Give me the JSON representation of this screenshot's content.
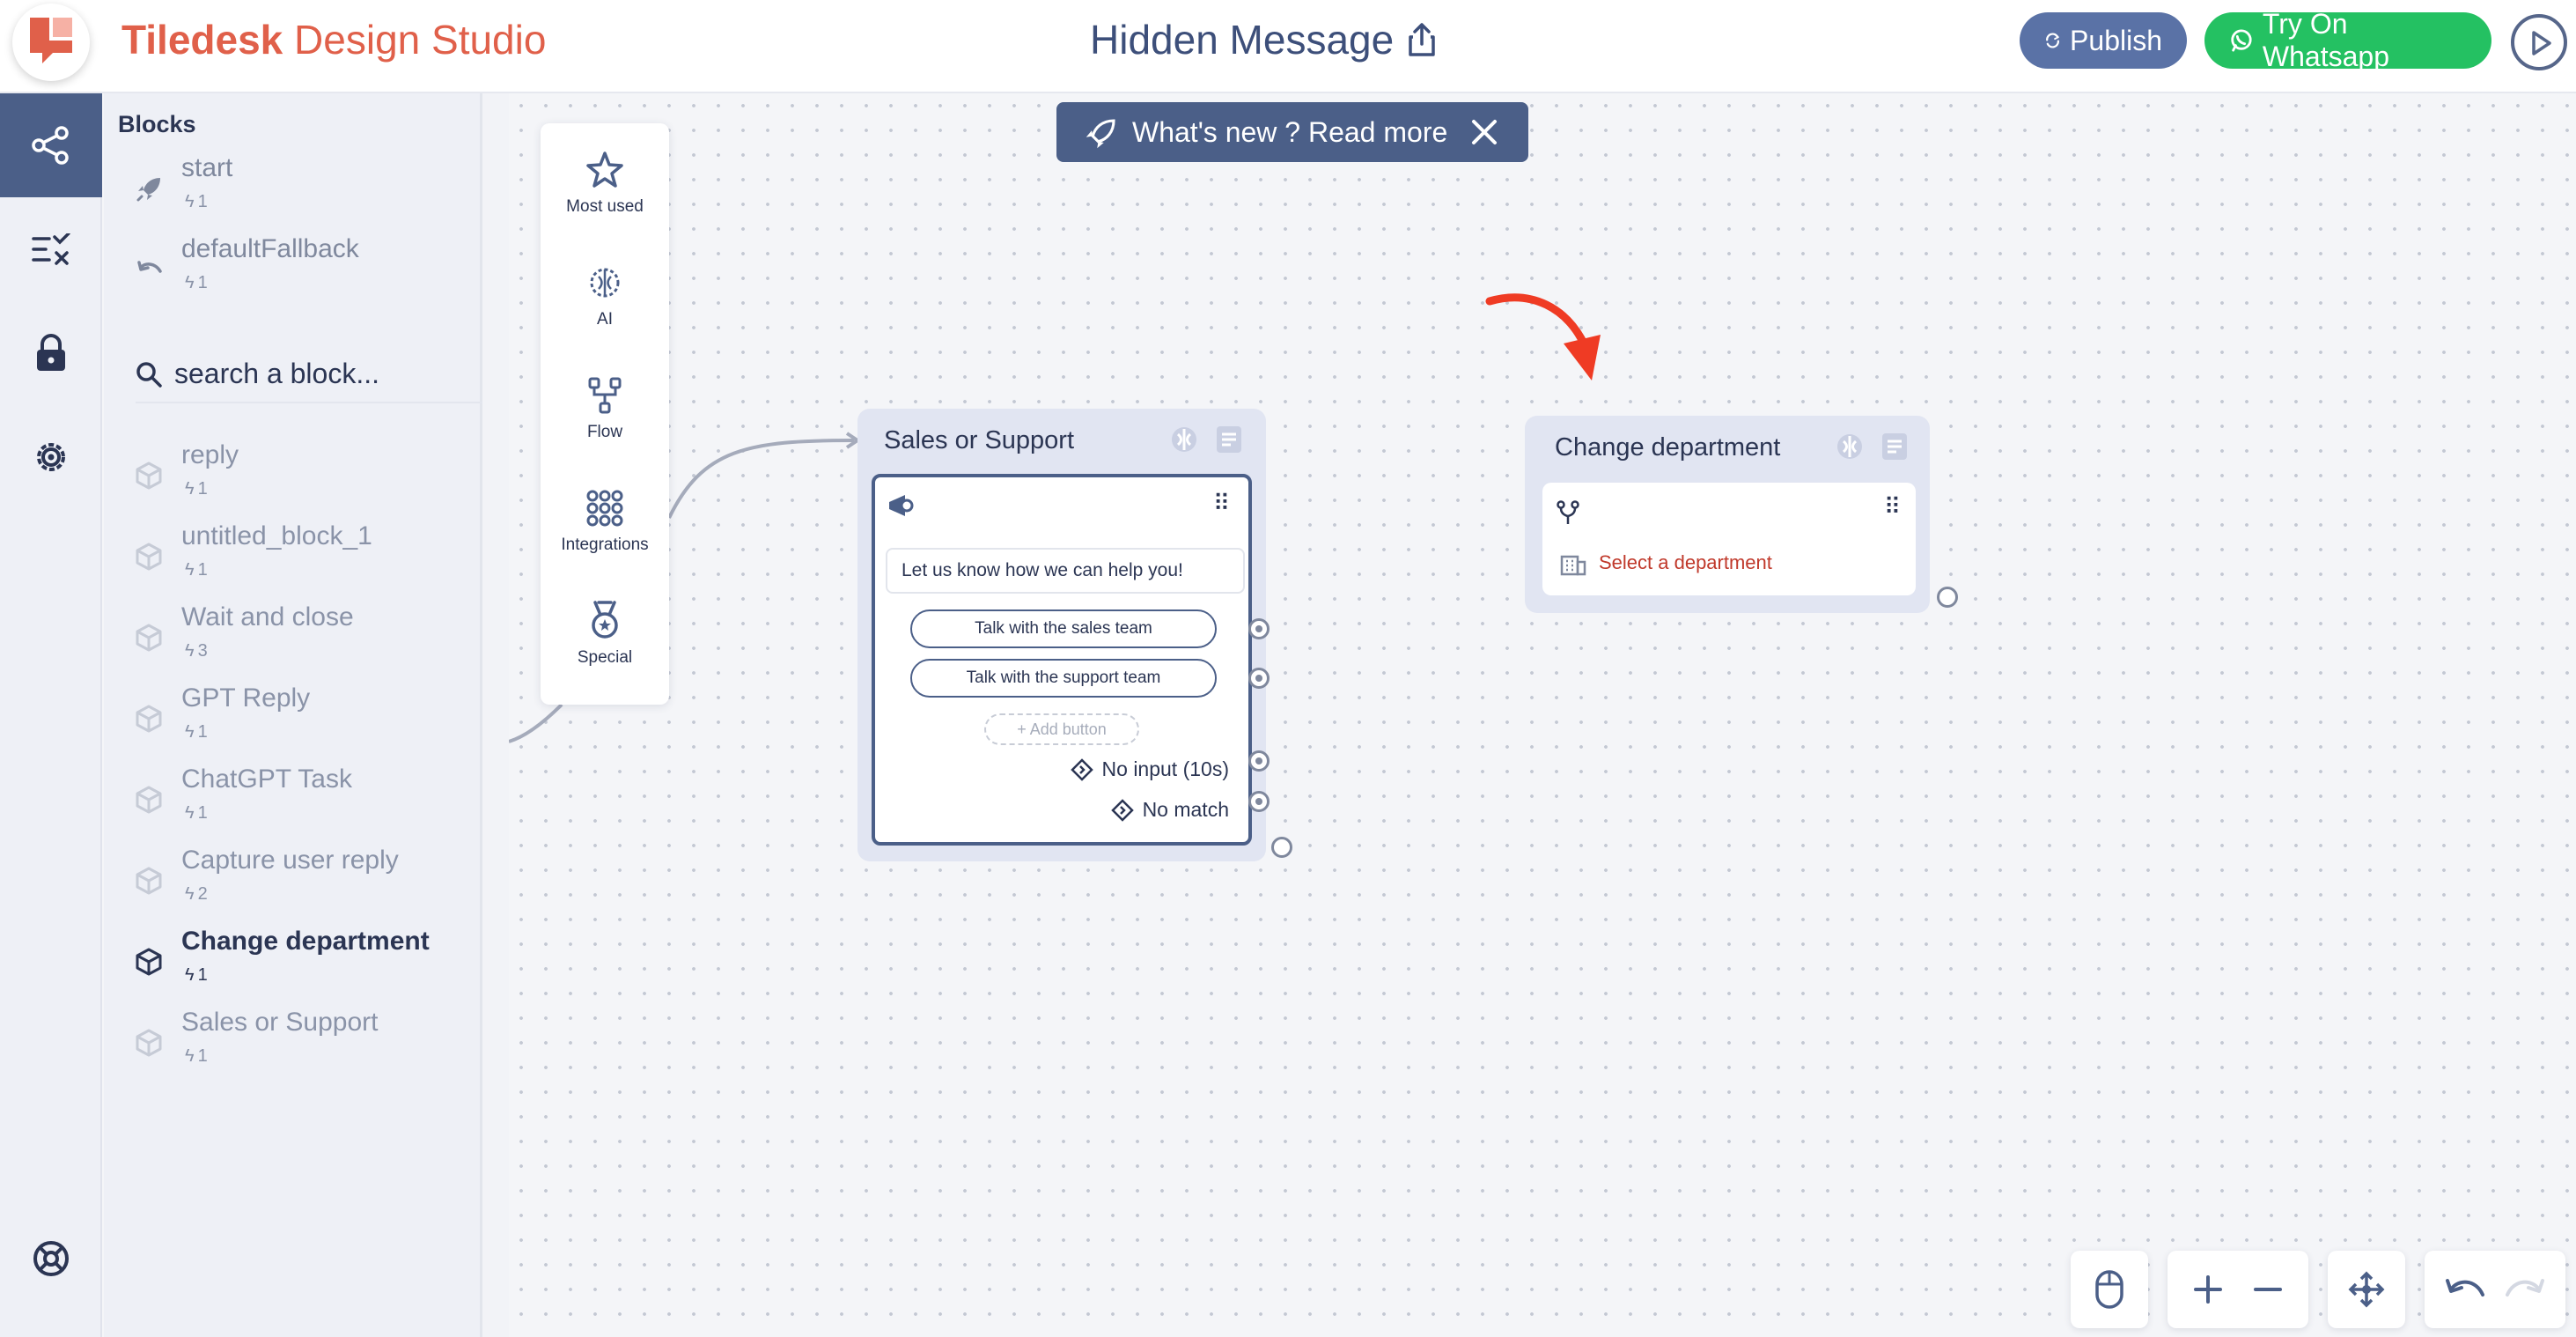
{
  "header": {
    "brand_bold": "Tiledesk",
    "brand_light": "Design Studio",
    "flow_title": "Hidden Message",
    "publish_label": "Publish",
    "whatsapp_label": "Try On Whatsapp"
  },
  "sidebar": {
    "title": "Blocks",
    "fixed_blocks": [
      {
        "name": "start",
        "count": "1"
      },
      {
        "name": "defaultFallback",
        "count": "1"
      }
    ],
    "search_placeholder": "search a block...",
    "blocks": [
      {
        "name": "reply",
        "count": "1"
      },
      {
        "name": "untitled_block_1",
        "count": "1"
      },
      {
        "name": "Wait and close",
        "count": "3"
      },
      {
        "name": "GPT Reply",
        "count": "1"
      },
      {
        "name": "ChatGPT Task",
        "count": "1"
      },
      {
        "name": "Capture user reply",
        "count": "2"
      },
      {
        "name": "Change department",
        "count": "1"
      },
      {
        "name": "Sales or Support",
        "count": "1"
      }
    ]
  },
  "banner": {
    "text": "What's new ? Read more"
  },
  "palette": {
    "items": [
      {
        "label": "Most used"
      },
      {
        "label": "AI"
      },
      {
        "label": "Flow"
      },
      {
        "label": "Integrations"
      },
      {
        "label": "Special"
      }
    ]
  },
  "node_sales": {
    "title": "Sales or Support",
    "message": "Let us know how we can help you!",
    "buttons": [
      "Talk with the sales team",
      "Talk with the support team"
    ],
    "add_button": "+ Add button",
    "no_input": "No input (10s)",
    "no_match": "No match"
  },
  "node_dept": {
    "title": "Change department",
    "select_label": "Select a department"
  },
  "colors": {
    "brand": "#e0604a",
    "primary": "#4b5f88",
    "whatsapp": "#24c162",
    "annotation_arrow": "#ef3b24",
    "warning_text": "#c0392b"
  }
}
